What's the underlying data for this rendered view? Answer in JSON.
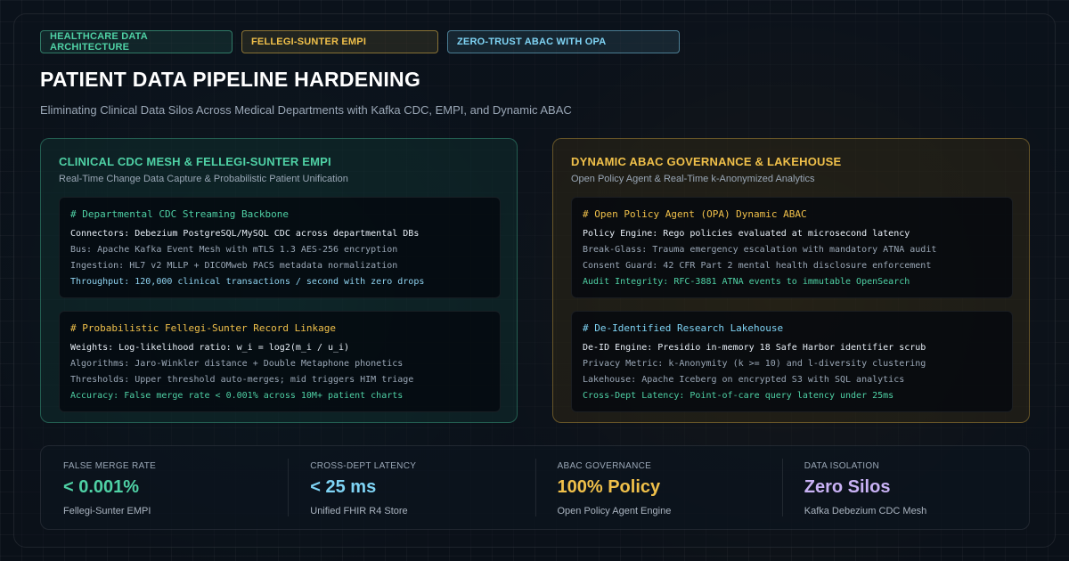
{
  "tags": [
    {
      "label": "HEALTHCARE DATA ARCHITECTURE"
    },
    {
      "label": "FELLEGI-SUNTER EMPI"
    },
    {
      "label": "ZERO-TRUST ABAC WITH OPA"
    }
  ],
  "header": {
    "title": "PATIENT DATA PIPELINE HARDENING",
    "subtitle": "Eliminating Clinical Data Silos Across Medical Departments with Kafka CDC, EMPI, and Dynamic ABAC"
  },
  "left_panel": {
    "title": "CLINICAL CDC MESH & FELLEGI-SUNTER EMPI",
    "subtitle": "Real-Time Change Data Capture & Probabilistic Patient Unification",
    "blocks": [
      {
        "heading": "# Departmental CDC Streaming Backbone",
        "lines": [
          "Connectors: Debezium PostgreSQL/MySQL CDC across departmental DBs",
          "Bus: Apache Kafka Event Mesh with mTLS 1.3 AES-256 encryption",
          "Ingestion: HL7 v2 MLLP + DICOMweb PACS metadata normalization",
          "Throughput: 120,000 clinical transactions / second with zero drops"
        ]
      },
      {
        "heading": "# Probabilistic Fellegi-Sunter Record Linkage",
        "lines": [
          "Weights: Log-likelihood ratio: w_i = log2(m_i / u_i)",
          "Algorithms: Jaro-Winkler distance + Double Metaphone phonetics",
          "Thresholds: Upper threshold auto-merges; mid triggers HIM triage",
          "Accuracy: False merge rate < 0.001% across 10M+ patient charts"
        ]
      }
    ]
  },
  "right_panel": {
    "title": "DYNAMIC ABAC GOVERNANCE & LAKEHOUSE",
    "subtitle": "Open Policy Agent & Real-Time k-Anonymized Analytics",
    "blocks": [
      {
        "heading": "# Open Policy Agent (OPA) Dynamic ABAC",
        "lines": [
          "Policy Engine: Rego policies evaluated at microsecond latency",
          "Break-Glass: Trauma emergency escalation with mandatory ATNA audit",
          "Consent Guard: 42 CFR Part 2 mental health disclosure enforcement",
          "Audit Integrity: RFC-3881 ATNA events to immutable OpenSearch"
        ]
      },
      {
        "heading": "# De-Identified Research Lakehouse",
        "lines": [
          "De-ID Engine: Presidio in-memory 18 Safe Harbor identifier scrub",
          "Privacy Metric: k-Anonymity (k >= 10) and l-diversity clustering",
          "Lakehouse: Apache Iceberg on encrypted S3 with SQL analytics",
          "Cross-Dept Latency: Point-of-care query latency under 25ms"
        ]
      }
    ]
  },
  "stats": [
    {
      "label": "FALSE MERGE RATE",
      "value": "< 0.001%",
      "desc": "Fellegi-Sunter EMPI"
    },
    {
      "label": "CROSS-DEPT LATENCY",
      "value": "< 25 ms",
      "desc": "Unified FHIR R4 Store"
    },
    {
      "label": "ABAC GOVERNANCE",
      "value": "100% Policy",
      "desc": "Open Policy Agent Engine"
    },
    {
      "label": "DATA ISOLATION",
      "value": "Zero Silos",
      "desc": "Kafka Debezium CDC Mesh"
    }
  ],
  "colors": {
    "green": "#4fd1a5",
    "amber": "#f0c04a",
    "blue": "#7fd4f5",
    "purple": "#c9b2f5",
    "background": "#0a1018"
  }
}
